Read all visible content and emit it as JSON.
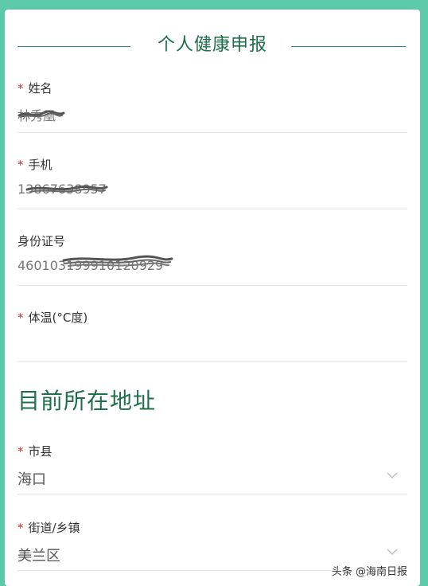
{
  "form": {
    "title": "个人健康申报",
    "fields": [
      {
        "label": "姓名",
        "required": true,
        "value": "林秀凰"
      },
      {
        "label": "手机",
        "required": true,
        "value": "13867638957"
      },
      {
        "label": "身份证号",
        "required": false,
        "value": "460103199910120929"
      },
      {
        "label": "体温(°C度)",
        "required": true,
        "value": ""
      }
    ],
    "required_mark": "*"
  },
  "address": {
    "title": "目前所在地址",
    "fields": [
      {
        "label": "市县",
        "required": true,
        "value": "海口"
      },
      {
        "label": "街道/乡镇",
        "required": true,
        "value": "美兰区"
      }
    ]
  },
  "watermark": "头条 @海南日报",
  "icons": {
    "dropdown": "chevron-down-icon"
  },
  "colors": {
    "accent": "#1f6f4a",
    "background": "#5ec9a9",
    "required": "#c0392b"
  }
}
